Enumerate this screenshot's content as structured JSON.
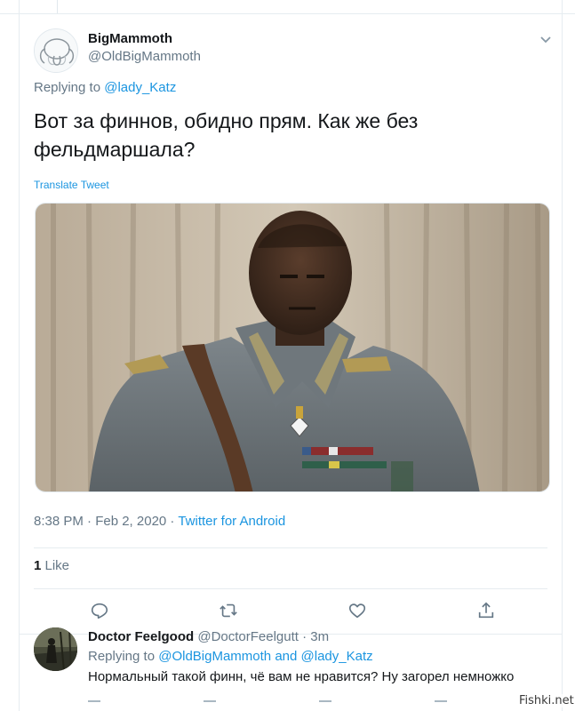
{
  "tweet": {
    "author_name": "BigMammoth",
    "author_handle": "@OldBigMammoth",
    "replying_prefix": "Replying to",
    "replying_mention": "@lady_Katz",
    "text": "Вот за финнов, обидно прям. Как же без фельдмаршала?",
    "translate_label": "Translate Tweet",
    "timestamp": "8:38 PM · Feb 2, 2020 · ",
    "client": "Twitter for Android",
    "likes_count": "1",
    "likes_label": " Like",
    "icons": {
      "caret": "chevron-down-icon",
      "reply": "reply-icon",
      "retweet": "retweet-icon",
      "like": "heart-icon",
      "share": "share-icon"
    },
    "colors": {
      "link": "#1b95e0",
      "secondary_text": "#657786",
      "primary_text": "#14171a",
      "divider": "#e6ecf0"
    }
  },
  "reply": {
    "author_name": "Doctor Feelgood",
    "author_handle": "@DoctorFeelgutt",
    "time": "· 3m",
    "replying_prefix": "Replying to",
    "mention_1": "@OldBigMammoth",
    "and_word": "and",
    "mention_2": "@lady_Katz",
    "text": "Нормальный такой финн, чё вам не нравится? Ну загорел немножко"
  },
  "watermark": "Fishki.net"
}
